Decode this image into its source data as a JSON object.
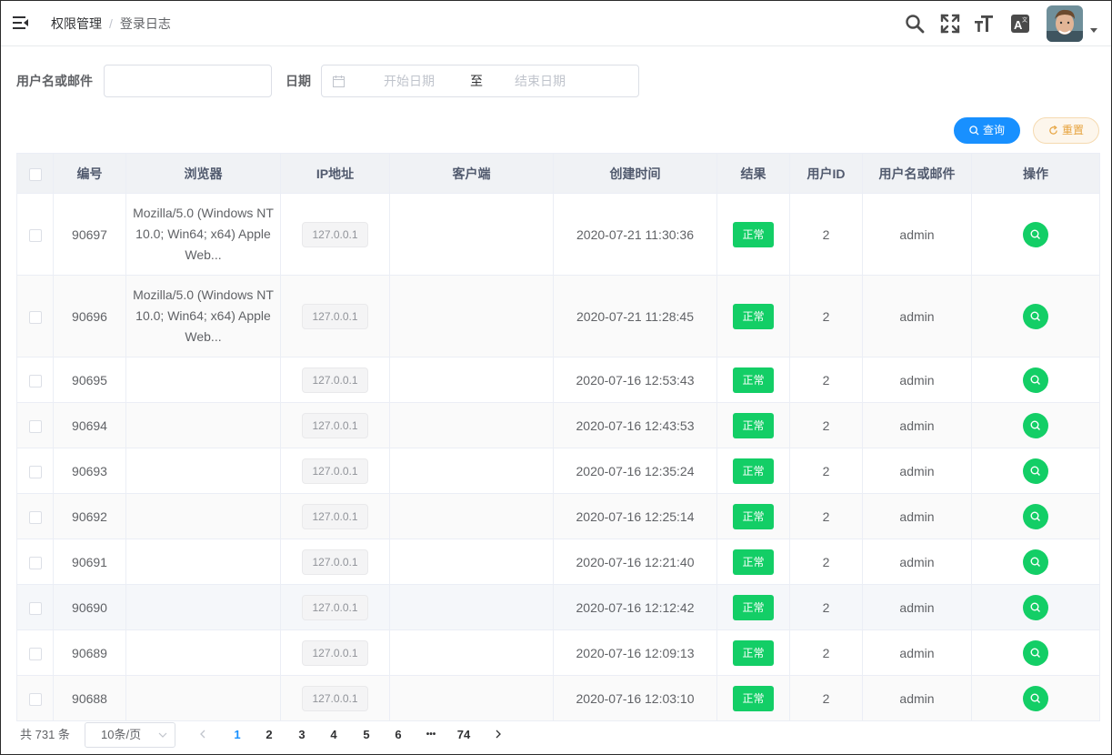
{
  "header": {
    "breadcrumb": [
      "权限管理",
      "登录日志"
    ],
    "breadcrumb_sep": "/",
    "icons": [
      "menu-fold-icon",
      "search-icon",
      "fullscreen-icon",
      "font-size-icon",
      "translate-icon"
    ]
  },
  "filter": {
    "username_label": "用户名或邮件",
    "username_value": "",
    "date_label": "日期",
    "start_placeholder": "开始日期",
    "range_separator": "至",
    "end_placeholder": "结束日期",
    "search_label": "查询",
    "reset_label": "重置"
  },
  "table": {
    "columns": [
      "编号",
      "浏览器",
      "IP地址",
      "客户端",
      "创建时间",
      "结果",
      "用户ID",
      "用户名或邮件",
      "操作"
    ],
    "rows": [
      {
        "id": "90697",
        "browser": "Mozilla/5.0 (Windows NT 10.0; Win64; x64) AppleWeb...",
        "ip": "127.0.0.1",
        "client": "",
        "time": "2020-07-21 11:30:36",
        "result": "正常",
        "uid": "2",
        "user": "admin"
      },
      {
        "id": "90696",
        "browser": "Mozilla/5.0 (Windows NT 10.0; Win64; x64) AppleWeb...",
        "ip": "127.0.0.1",
        "client": "",
        "time": "2020-07-21 11:28:45",
        "result": "正常",
        "uid": "2",
        "user": "admin"
      },
      {
        "id": "90695",
        "browser": "",
        "ip": "127.0.0.1",
        "client": "",
        "time": "2020-07-16 12:53:43",
        "result": "正常",
        "uid": "2",
        "user": "admin"
      },
      {
        "id": "90694",
        "browser": "",
        "ip": "127.0.0.1",
        "client": "",
        "time": "2020-07-16 12:43:53",
        "result": "正常",
        "uid": "2",
        "user": "admin"
      },
      {
        "id": "90693",
        "browser": "",
        "ip": "127.0.0.1",
        "client": "",
        "time": "2020-07-16 12:35:24",
        "result": "正常",
        "uid": "2",
        "user": "admin"
      },
      {
        "id": "90692",
        "browser": "",
        "ip": "127.0.0.1",
        "client": "",
        "time": "2020-07-16 12:25:14",
        "result": "正常",
        "uid": "2",
        "user": "admin"
      },
      {
        "id": "90691",
        "browser": "",
        "ip": "127.0.0.1",
        "client": "",
        "time": "2020-07-16 12:21:40",
        "result": "正常",
        "uid": "2",
        "user": "admin"
      },
      {
        "id": "90690",
        "browser": "",
        "ip": "127.0.0.1",
        "client": "",
        "time": "2020-07-16 12:12:42",
        "result": "正常",
        "uid": "2",
        "user": "admin"
      },
      {
        "id": "90689",
        "browser": "",
        "ip": "127.0.0.1",
        "client": "",
        "time": "2020-07-16 12:09:13",
        "result": "正常",
        "uid": "2",
        "user": "admin"
      },
      {
        "id": "90688",
        "browser": "",
        "ip": "127.0.0.1",
        "client": "",
        "time": "2020-07-16 12:03:10",
        "result": "正常",
        "uid": "2",
        "user": "admin"
      }
    ]
  },
  "pagination": {
    "total_text": "共 731 条",
    "page_size": "10条/页",
    "pages": [
      "1",
      "2",
      "3",
      "4",
      "5",
      "6",
      "•••",
      "74"
    ],
    "current": "1"
  },
  "colors": {
    "primary": "#1890ff",
    "success": "#13ce66",
    "warning": "#e6a23c"
  }
}
